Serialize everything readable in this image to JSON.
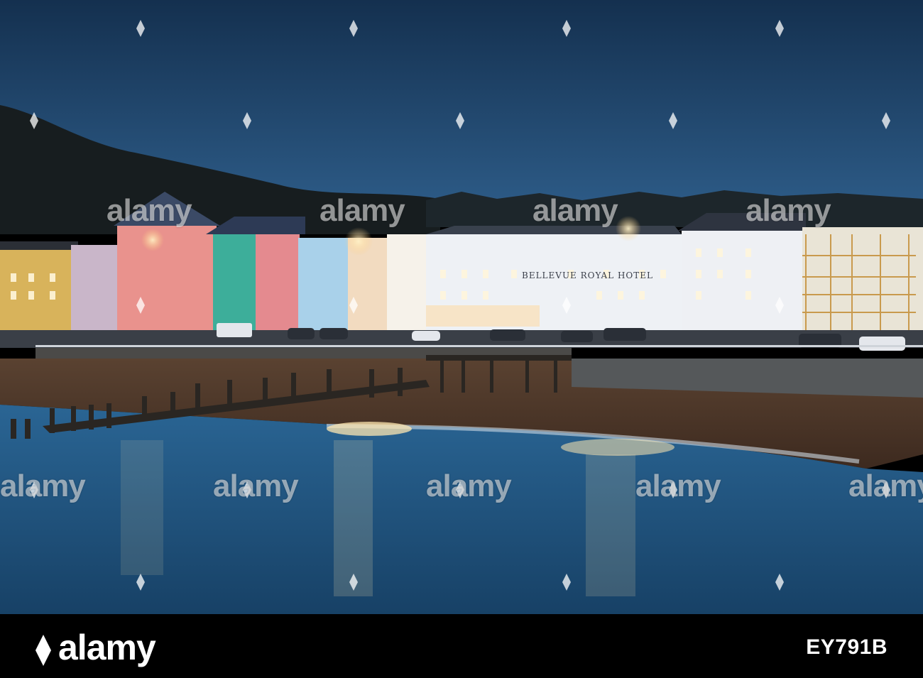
{
  "image": {
    "subject": "Seafront promenade at dusk with colorful terraced buildings, hotel, jetty and sea reflections",
    "hotel_sign": "BELLEVUE ROYAL HOTEL",
    "palette": {
      "sky_top": "#16304f",
      "sky_bottom": "#2c5a86",
      "hill": "#161c1e",
      "sea": "#1f4f79",
      "sand": "#4a3426",
      "lights": "#ffd79a"
    }
  },
  "watermark": {
    "text": "alamy"
  },
  "footer": {
    "logo": "alamy",
    "image_id": "EY791B"
  }
}
